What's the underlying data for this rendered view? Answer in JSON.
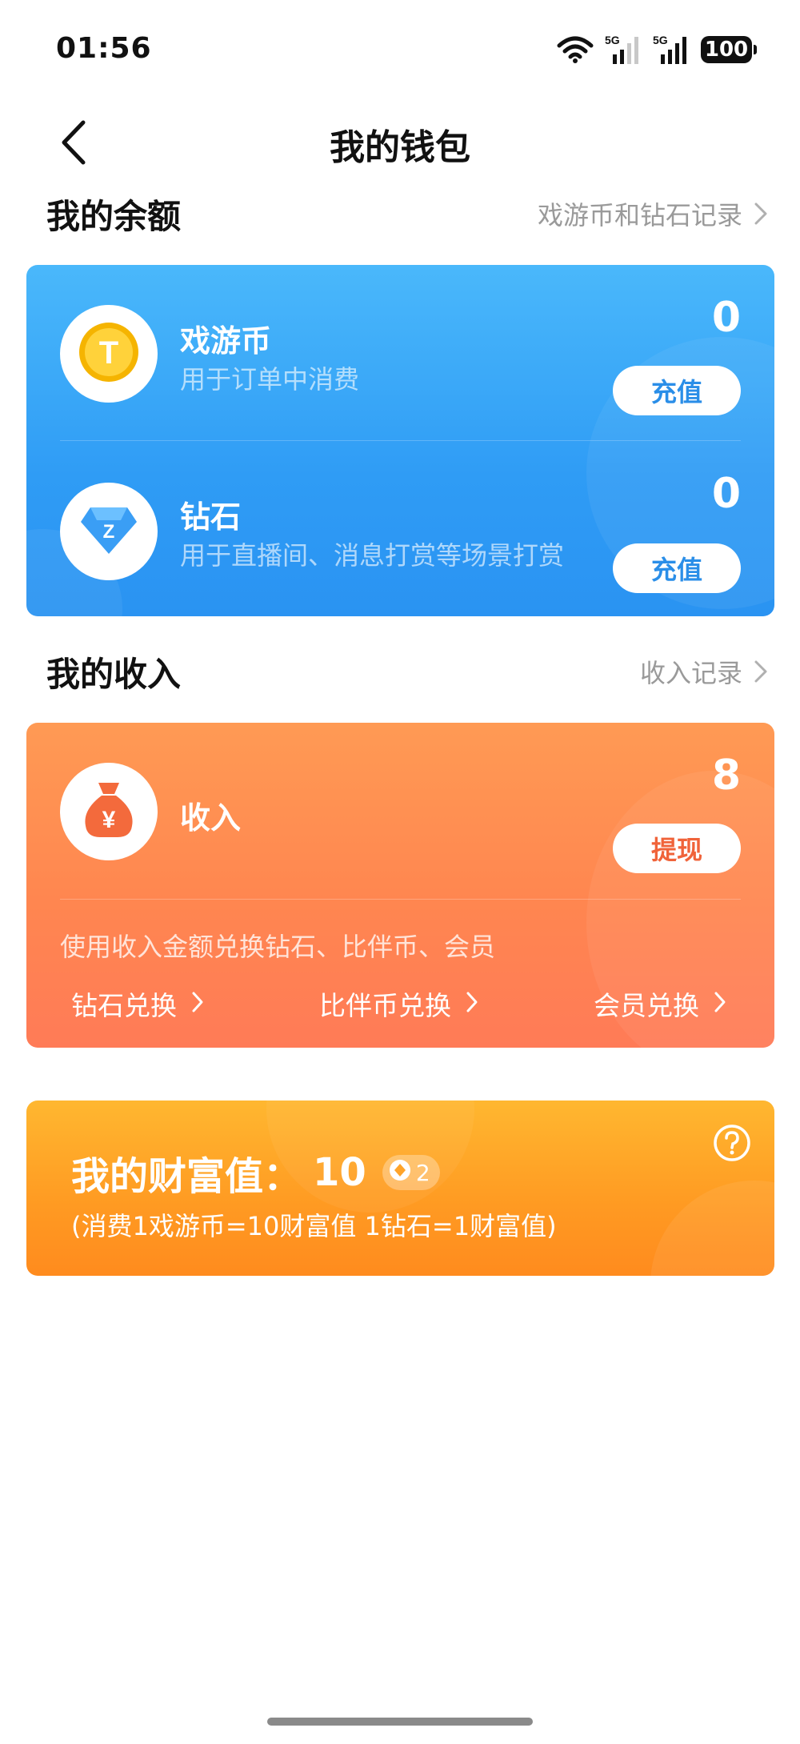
{
  "status_bar": {
    "time": "01:56",
    "signal1_label": "5G",
    "signal2_label": "5G",
    "battery": "100"
  },
  "nav": {
    "title": "我的钱包",
    "back_icon": "chevron-left-icon"
  },
  "balance_section": {
    "title": "我的余额",
    "link_label": "戏游币和钻石记录"
  },
  "balance_items": [
    {
      "name": "戏游币",
      "description": "用于订单中消费",
      "amount": "0",
      "button_label": "充值",
      "icon": "gold-coin-icon",
      "icon_letter": "T"
    },
    {
      "name": "钻石",
      "description": "用于直播间、消息打赏等场景打赏",
      "amount": "0",
      "button_label": "充值",
      "icon": "diamond-icon",
      "icon_letter": "Z"
    }
  ],
  "income_section": {
    "title": "我的收入",
    "link_label": "收入记录"
  },
  "income": {
    "name": "收入",
    "amount": "8",
    "button_label": "提现",
    "icon": "money-bag-icon",
    "icon_symbol": "¥",
    "description": "使用收入金额兑换钻石、比伴币、会员",
    "links": [
      "钻石兑换",
      "比伴币兑换",
      "会员兑换"
    ]
  },
  "wealth": {
    "label": "我的财富值：",
    "value": "10",
    "badge_value": "2",
    "note": "(消费1戏游币=10财富值 1钻石=1财富值)",
    "help_icon": "question-circle-icon"
  },
  "colors": {
    "balance_card_top": "#4ab8fb",
    "balance_card_bottom": "#2a93f2",
    "income_card_top": "#ff9a54",
    "income_card_bottom": "#ff7b57",
    "wealth_card_top": "#ffb730",
    "wealth_card_bottom": "#ff8b1e",
    "button_blue_text": "#2a8ee8",
    "button_orange_text": "#f0633a"
  }
}
